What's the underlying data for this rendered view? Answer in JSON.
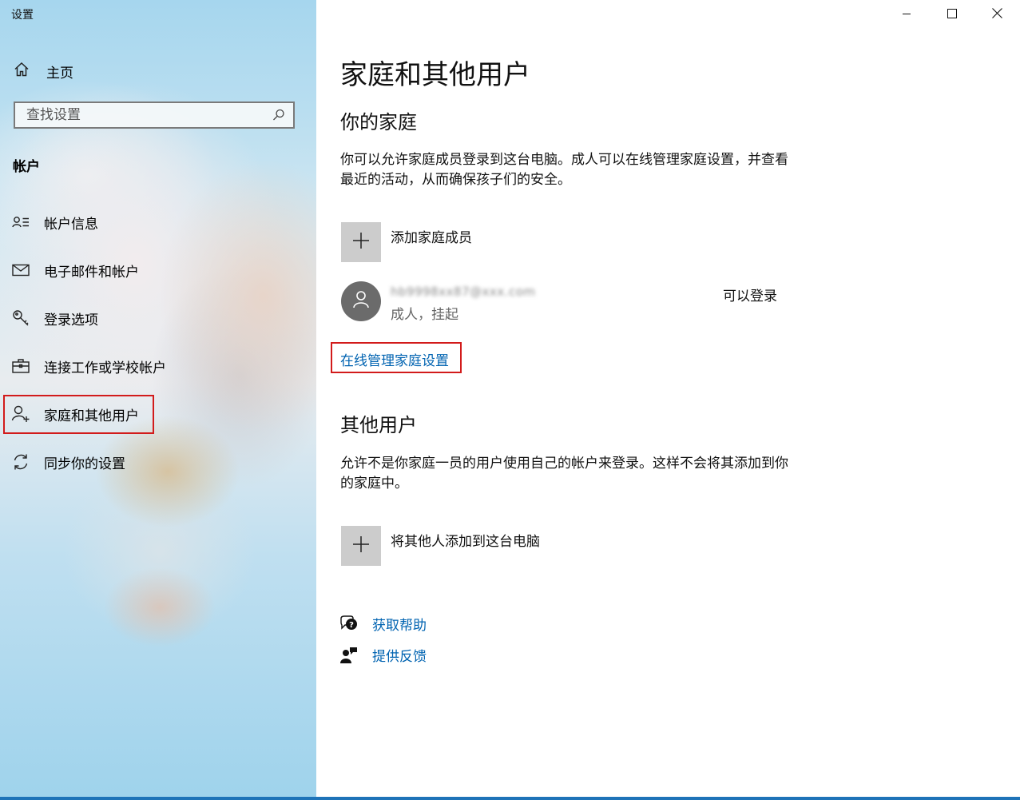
{
  "window": {
    "title": "设置",
    "controls": [
      "minimize",
      "maximize",
      "close"
    ]
  },
  "sidebar": {
    "home_label": "主页",
    "search_placeholder": "查找设置",
    "section_title": "帐户",
    "items": [
      {
        "label": "帐户信息",
        "icon": "account-info-icon"
      },
      {
        "label": "电子邮件和帐户",
        "icon": "mail-icon"
      },
      {
        "label": "登录选项",
        "icon": "key-icon"
      },
      {
        "label": "连接工作或学校帐户",
        "icon": "briefcase-icon"
      },
      {
        "label": "家庭和其他用户",
        "icon": "person-add-icon",
        "selected": true
      },
      {
        "label": "同步你的设置",
        "icon": "sync-icon"
      }
    ]
  },
  "main": {
    "title": "家庭和其他用户",
    "family": {
      "heading": "你的家庭",
      "description": "你可以允许家庭成员登录到这台电脑。成人可以在线管理家庭设置，并查看最近的活动，从而确保孩子们的安全。",
      "add_label": "添加家庭成员",
      "member": {
        "email": "hb9998xx87@xxx.com",
        "role": "成人，挂起",
        "status": "可以登录"
      },
      "manage_link": "在线管理家庭设置"
    },
    "other_users": {
      "heading": "其他用户",
      "description": "允许不是你家庭一员的用户使用自己的帐户来登录。这样不会将其添加到你的家庭中。",
      "add_label": "将其他人添加到这台电脑"
    },
    "help": {
      "get_help": "获取帮助",
      "feedback": "提供反馈"
    }
  },
  "colors": {
    "link": "#0063b1",
    "highlight_border": "#d21b1b",
    "tile": "#cccccc",
    "avatar": "#6b6b6b",
    "taskbar_accent": "#1e73b8"
  }
}
